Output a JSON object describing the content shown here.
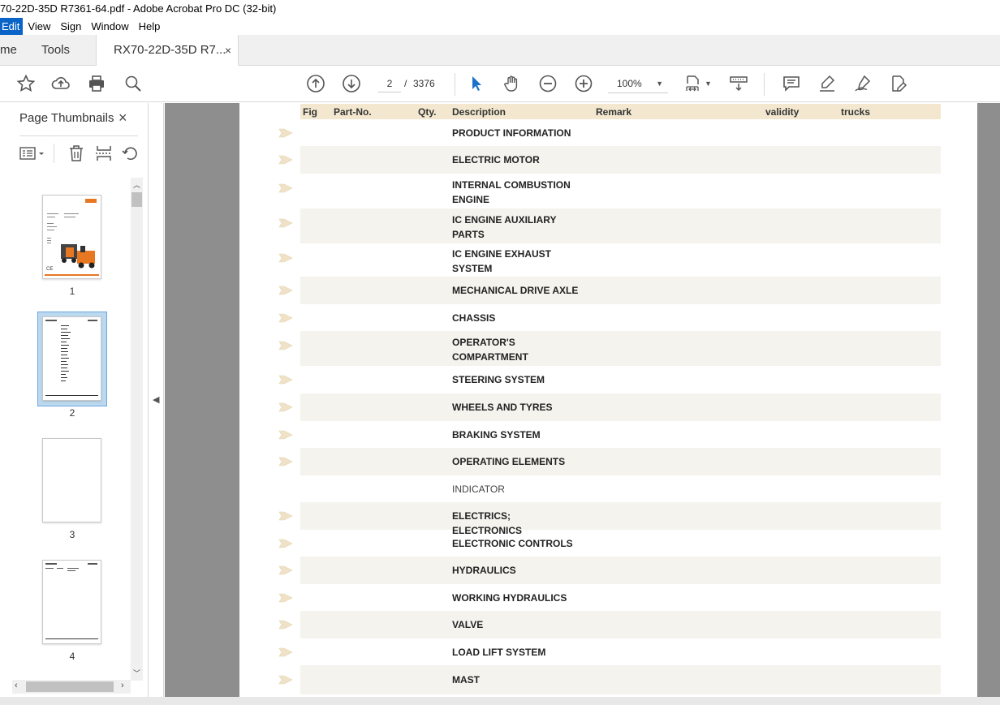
{
  "window": {
    "title": "70-22D-35D  R7361-64.pdf - Adobe Acrobat Pro DC (32-bit)"
  },
  "menu": {
    "items": [
      "Edit",
      "View",
      "Sign",
      "Window",
      "Help"
    ]
  },
  "tabs": {
    "home": "me",
    "tools": "Tools",
    "document": "RX70-22D-35D  R7...",
    "close": "×"
  },
  "toolbar": {
    "page_current": "2",
    "page_separator": "/",
    "page_total": "3376",
    "zoom": "100%",
    "icons": [
      "star-icon",
      "upload-icon",
      "print-icon",
      "search-zoom-icon",
      "page-up-icon",
      "page-down-icon",
      "select-cursor-icon",
      "hand-icon",
      "zoom-out-icon",
      "zoom-in-icon",
      "fit-page-icon",
      "scroll-mode-icon",
      "comment-icon",
      "highlight-icon",
      "sign-icon",
      "edit-pdf-icon"
    ]
  },
  "panel": {
    "title": "Page Thumbnails",
    "close": "×",
    "thumbnails": [
      {
        "label": "1",
        "selected": false
      },
      {
        "label": "2",
        "selected": true
      },
      {
        "label": "3",
        "selected": false
      },
      {
        "label": "4",
        "selected": false
      }
    ]
  },
  "document": {
    "headers": [
      "Fig",
      "Part-No.",
      "Qty.",
      "Description",
      "Remark",
      "validity",
      "trucks"
    ],
    "rows": [
      {
        "desc": "PRODUCT INFORMATION",
        "arrow": true
      },
      {
        "desc": "ELECTRIC MOTOR",
        "arrow": true
      },
      {
        "desc": "INTERNAL COMBUSTION ENGINE",
        "arrow": true
      },
      {
        "desc": "IC ENGINE AUXILIARY PARTS",
        "arrow": true
      },
      {
        "desc": "IC ENGINE EXHAUST SYSTEM",
        "arrow": true
      },
      {
        "desc": "MECHANICAL DRIVE AXLE",
        "arrow": true
      },
      {
        "desc": "CHASSIS",
        "arrow": true
      },
      {
        "desc": "OPERATOR'S COMPARTMENT",
        "arrow": true
      },
      {
        "desc": "STEERING SYSTEM",
        "arrow": true
      },
      {
        "desc": "WHEELS AND TYRES",
        "arrow": true
      },
      {
        "desc": "BRAKING SYSTEM",
        "arrow": true
      },
      {
        "desc": "OPERATING ELEMENTS",
        "arrow": true
      },
      {
        "desc": "INDICATOR",
        "arrow": false
      },
      {
        "desc": "ELECTRICS; ELECTRONICS",
        "arrow": true
      },
      {
        "desc": "ELECTRONIC CONTROLS",
        "arrow": true
      },
      {
        "desc": "HYDRAULICS",
        "arrow": true
      },
      {
        "desc": "WORKING HYDRAULICS",
        "arrow": true
      },
      {
        "desc": "VALVE",
        "arrow": true
      },
      {
        "desc": "LOAD LIFT SYSTEM",
        "arrow": true
      },
      {
        "desc": "MAST",
        "arrow": true
      }
    ]
  },
  "colors": {
    "accent": "#0a64c8",
    "header_bg": "#f3e8cf",
    "row_shade": "#f4f3ee",
    "viewport_bg": "#8e8e8e"
  }
}
